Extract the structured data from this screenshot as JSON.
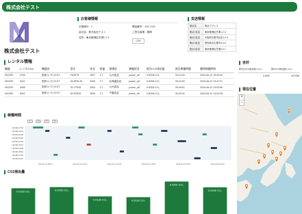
{
  "header": {
    "title": "株式会社テスト"
  },
  "company": {
    "name": "株式会社テスト"
  },
  "customer": {
    "title": "お客様情報",
    "id": "お客様ID：1",
    "company": "会社名：株式会社テスト",
    "address": "住所：東京都港区芝浦1-2-3",
    "phone": "電話番号：1112-1111",
    "contract": "ご担当者様：御様",
    "csv_label": "CSV"
  },
  "branch": {
    "title": "支店情報",
    "rows": [
      {
        "key": "拠点名",
        "value": "拠点アドレス"
      },
      {
        "key": "拠点1支店",
        "value": "東京都港区芝浦1-2-3"
      },
      {
        "key": "拠点2支店",
        "value": "大阪府大阪市北区1-2-3"
      },
      {
        "key": "拠点3支店",
        "value": "愛知県名古屋市2-3-5"
      },
      {
        "key": "拠点4支店",
        "value": "東京都港区芝浦3-4-1"
      }
    ]
  },
  "rental": {
    "title": "レンタル情報",
    "columns": [
      "機器",
      "レンタルNo",
      "機器名",
      "型式",
      "年式",
      "排量",
      "現場名",
      "稼働状況",
      "前日CO2排出量",
      "前日稼働時間",
      "最終稼働時刻"
    ],
    "rows": [
      [
        "HK20FL",
        "4706",
        "型枠ﾌｫｰｸﾘﾌﾄ2.5T",
        "FD25T3",
        "2007",
        "2.7",
        "九州支店",
        "power_off",
        "0.0024t-CO₂",
        "00:12:03",
        "2024-06-12 13:03:49"
      ],
      [
        "HK20FL",
        "3210",
        "型枠ﾌｫｰｸﾘﾌﾄ2.5T",
        "02-8FDL25",
        "2006",
        "2.7",
        "北海道支店",
        "power_off",
        "0.0030t-CO₂",
        "00:10:26",
        "2024-06-12 13:47:12"
      ],
      [
        "HK20FL",
        "4008",
        "型枠ﾌｫｰｸﾘﾌﾄ2.5T",
        "02-7FD25",
        "2003",
        "2.7",
        "九州支店",
        "power_off",
        "0.0031t-CO₂",
        "00:09:52",
        "2024-06-12 13:03:58"
      ],
      [
        "HK20FL",
        "8342",
        "型枠ﾌｫｰｸﾘﾌﾄ2.5T",
        "02-8FD25",
        "2005",
        "2.7",
        "千葉支店",
        "power_off",
        "0.0024t-CO₂",
        "00:29:24",
        "2024-06-12 13:04:28"
      ]
    ]
  },
  "timeline": {
    "title": "稼働時間",
    "filters": [
      "1日",
      "1週",
      "1月",
      "1年"
    ],
    "rows": [
      "HK20FL4706",
      "HK20FL3210",
      "HK20FL4008",
      "HK20FL8342",
      "HK20FL4706",
      "HK20FL3210",
      "HK20FL4008",
      "HK20FL8342",
      "HK20FL4706",
      "HK20FL3210"
    ],
    "ticks": [
      "2024-06-12 08:00",
      "2024-06-12 12:00",
      "2024-06-12 16:00",
      "2024-06-12 20:00",
      "2024-06-13 00:00",
      "2024-06-13 04:00"
    ],
    "bar_colors": [
      "#2e8b57",
      "#1b2a4a",
      "#c0392b"
    ]
  },
  "co2": {
    "title": "CO2排出量",
    "bars": [
      {
        "label": "0.0199 CO₂",
        "value": 0.0199
      },
      {
        "label": "0.0208 CO₂",
        "value": 0.0208
      },
      {
        "label": "0.0136 CO₂",
        "value": 0.0136
      },
      {
        "label": "0.0130 CO₂",
        "value": 0.013
      },
      {
        "label": "0.0251 CO₂",
        "value": 0.0251
      },
      {
        "label": "0.0206 CO₂",
        "value": 0.0206
      }
    ],
    "bar_color": "#1e7a3c"
  },
  "total": {
    "title": "合計",
    "col1": "昨日のCO2排出量(t-CO₂)",
    "col2": "累計CO2排出量(t-CO₂)",
    "val1": "0.3492",
    "val2": "40.0786"
  },
  "location": {
    "title": "現在位置",
    "zoom_in": "+",
    "zoom_out": "−",
    "marker_color": "#e67e22"
  }
}
